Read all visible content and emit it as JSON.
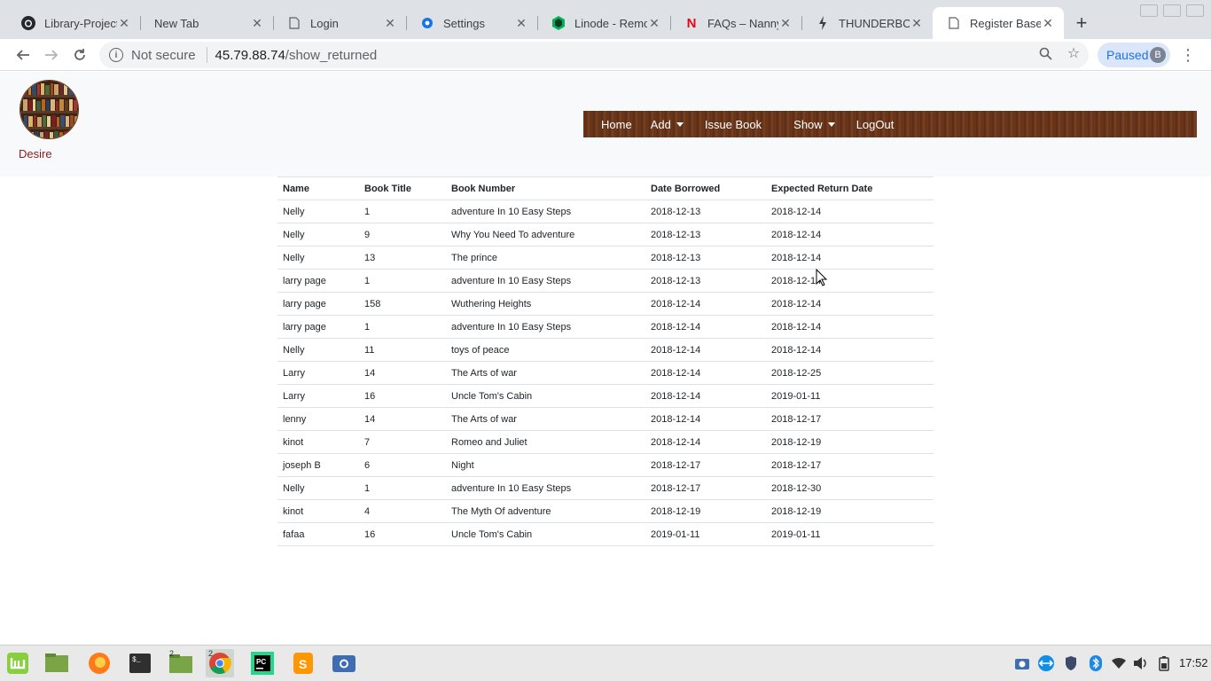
{
  "browser": {
    "tabs": [
      {
        "title": "Library-Project",
        "icon": "github-icon"
      },
      {
        "title": "New Tab",
        "icon": ""
      },
      {
        "title": "Login",
        "icon": "page-icon"
      },
      {
        "title": "Settings",
        "icon": "gear-icon"
      },
      {
        "title": "Linode - Remot",
        "icon": "linode-icon"
      },
      {
        "title": "FAQs – Nanny S",
        "icon": "nanny-icon"
      },
      {
        "title": "THUNDERBOLT",
        "icon": "bolt-icon"
      },
      {
        "title": "Register Base",
        "icon": "page-icon"
      }
    ],
    "security_label": "Not secure",
    "url_host": "45.79.88.74",
    "url_path": "/show_returned",
    "profile_status": "Paused",
    "profile_initial": "B"
  },
  "site": {
    "brand": "Desire",
    "nav": {
      "home": "Home",
      "add": "Add",
      "issue": "Issue Book",
      "show": "Show",
      "logout": "LogOut"
    }
  },
  "table": {
    "headers": [
      "Name",
      "Book Title",
      "Book Number",
      "Date Borrowed",
      "Expected Return Date"
    ],
    "rows": [
      [
        "Nelly",
        "1",
        "adventure In 10 Easy Steps",
        "2018-12-13",
        "2018-12-14"
      ],
      [
        "Nelly",
        "9",
        "Why You Need To adventure",
        "2018-12-13",
        "2018-12-14"
      ],
      [
        "Nelly",
        "13",
        "The prince",
        "2018-12-13",
        "2018-12-14"
      ],
      [
        "larry page",
        "1",
        "adventure In 10 Easy Steps",
        "2018-12-13",
        "2018-12-14"
      ],
      [
        "larry page",
        "158",
        "Wuthering Heights",
        "2018-12-14",
        "2018-12-14"
      ],
      [
        "larry page",
        "1",
        "adventure In 10 Easy Steps",
        "2018-12-14",
        "2018-12-14"
      ],
      [
        "Nelly",
        "11",
        "toys of peace",
        "2018-12-14",
        "2018-12-14"
      ],
      [
        "Larry",
        "14",
        "The Arts of war",
        "2018-12-14",
        "2018-12-25"
      ],
      [
        "Larry",
        "16",
        "Uncle Tom's Cabin",
        "2018-12-14",
        "2019-01-11"
      ],
      [
        "lenny",
        "14",
        "The Arts of war",
        "2018-12-14",
        "2018-12-17"
      ],
      [
        "kinot",
        "7",
        "Romeo and Juliet",
        "2018-12-14",
        "2018-12-19"
      ],
      [
        "joseph B",
        "6",
        "Night",
        "2018-12-17",
        "2018-12-17"
      ],
      [
        "Nelly",
        "1",
        "adventure In 10 Easy Steps",
        "2018-12-17",
        "2018-12-30"
      ],
      [
        "kinot",
        "4",
        "The Myth Of adventure",
        "2018-12-19",
        "2018-12-19"
      ],
      [
        "fafaa",
        "16",
        "Uncle Tom's Cabin",
        "2019-01-11",
        "2019-01-11"
      ]
    ]
  },
  "taskbar": {
    "clock": "17:52",
    "files_badge": "2",
    "chrome_badge": "2"
  }
}
